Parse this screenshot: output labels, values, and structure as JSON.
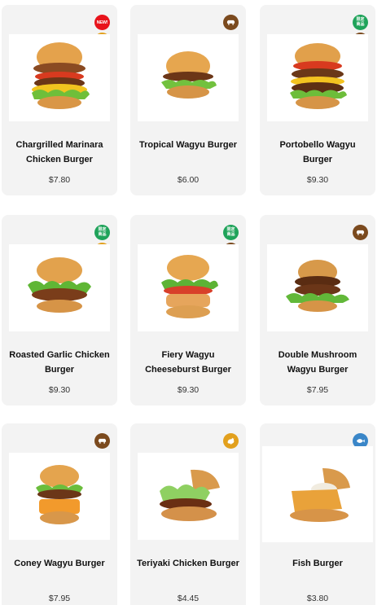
{
  "colors": {
    "card_background": "#f3f3f3",
    "new_badge": "#e8131b",
    "limited_badge": "#1fa35a",
    "beef_badge": "#7b4a1e",
    "chicken_badge": "#e2a01d",
    "spicy_badge": "#e0303b",
    "fish_badge": "#3a86c8"
  },
  "products": [
    {
      "name_line1": "Chargrilled Marinara",
      "name_line2": "Chicken Burger",
      "price": "$7.80",
      "badges": [
        "new-icon",
        "chicken-icon"
      ],
      "new_label": "NEW!"
    },
    {
      "name_line1": "Tropical Wagyu Burger",
      "name_line2": "",
      "price": "$6.00",
      "badges": [
        "beef-icon"
      ]
    },
    {
      "name_line1": "Portobello Wagyu",
      "name_line2": "Burger",
      "price": "$9.30",
      "badges": [
        "limited-icon",
        "beef-icon"
      ],
      "limited_label": "限定商品"
    },
    {
      "name_line1": "Roasted Garlic Chicken",
      "name_line2": "Burger",
      "price": "$9.30",
      "badges": [
        "limited-icon",
        "chicken-icon"
      ],
      "limited_label": "限定商品"
    },
    {
      "name_line1": "Fiery Wagyu",
      "name_line2": "Cheeseburst Burger",
      "price": "$9.30",
      "badges": [
        "limited-icon",
        "beef-icon",
        "spicy-icon"
      ],
      "limited_label": "限定商品"
    },
    {
      "name_line1": "Double Mushroom",
      "name_line2": "Wagyu Burger",
      "price": "$7.95",
      "badges": [
        "beef-icon"
      ]
    },
    {
      "name_line1": "Coney Wagyu Burger",
      "name_line2": "",
      "price": "$7.95",
      "badges": [
        "beef-icon"
      ]
    },
    {
      "name_line1": "Teriyaki Chicken Burger",
      "name_line2": "",
      "price": "$4.45",
      "badges": [
        "chicken-icon"
      ]
    },
    {
      "name_line1": "Fish Burger",
      "name_line2": "",
      "price": "$3.80",
      "badges": [
        "fish-icon"
      ]
    }
  ]
}
